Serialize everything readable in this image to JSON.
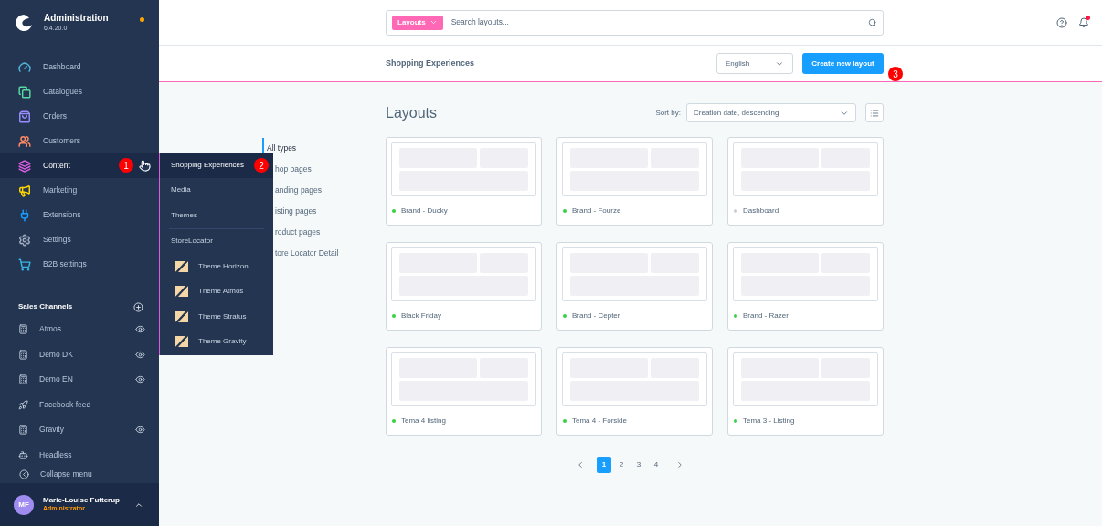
{
  "app": {
    "title": "Administration",
    "version": "6.4.20.0"
  },
  "sidebar": {
    "items": [
      {
        "label": "Dashboard",
        "color": "#4fb3d9",
        "selected": false
      },
      {
        "label": "Catalogues",
        "color": "#57d9a3",
        "selected": false
      },
      {
        "label": "Orders",
        "color": "#9a8cff",
        "selected": false
      },
      {
        "label": "Customers",
        "color": "#ff8a65",
        "selected": false
      },
      {
        "label": "Content",
        "color": "#d95fe0",
        "selected": true
      },
      {
        "label": "Marketing",
        "color": "#ffd700",
        "selected": false
      },
      {
        "label": "Extensions",
        "color": "#189eff",
        "selected": false
      },
      {
        "label": "Settings",
        "color": "#a0aec0",
        "selected": false
      },
      {
        "label": "B2B settings",
        "color": "#37b5e6",
        "selected": false
      }
    ]
  },
  "sales_channels": {
    "title": "Sales Channels",
    "items": [
      {
        "label": "Atmos",
        "kind": "storefront",
        "preview": true
      },
      {
        "label": "Demo DK",
        "kind": "storefront",
        "preview": true
      },
      {
        "label": "Demo EN",
        "kind": "storefront",
        "preview": true
      },
      {
        "label": "Facebook feed",
        "kind": "feed",
        "preview": false
      },
      {
        "label": "Gravity",
        "kind": "storefront",
        "preview": true
      },
      {
        "label": "Headless",
        "kind": "headless",
        "preview": false
      }
    ]
  },
  "collapse_menu": "Collapse menu",
  "user": {
    "initials": "MF",
    "name": "Marie-Louise Futterup",
    "role": "Administrator"
  },
  "submenu": {
    "items": [
      {
        "label": "Shopping Experiences",
        "selected": true
      },
      {
        "label": "Media",
        "selected": false
      },
      {
        "label": "Themes",
        "selected": false
      },
      {
        "label": "StoreLocator",
        "selected": false,
        "children": [
          {
            "label": "Theme Horizon"
          },
          {
            "label": "Theme Atmos"
          },
          {
            "label": "Theme Stratus"
          },
          {
            "label": "Theme Gravity"
          }
        ]
      }
    ]
  },
  "badges": [
    "1",
    "2",
    "3"
  ],
  "search": {
    "filter": "Layouts",
    "placeholder": "Search layouts..."
  },
  "page_title": "Shopping Experiences",
  "language": "English",
  "create_button": "Create new layout",
  "layouts": {
    "title": "Layouts",
    "sort_label": "Sort by:",
    "sort_value": "Creation date, descending",
    "types": [
      {
        "label": "All types",
        "selected": true
      },
      {
        "label": "hop pages",
        "selected": false
      },
      {
        "label": "anding pages",
        "selected": false
      },
      {
        "label": "isting pages",
        "selected": false
      },
      {
        "label": "roduct pages",
        "selected": false
      },
      {
        "label": "tore Locator Detail",
        "selected": false
      }
    ],
    "cards": [
      {
        "name": "Brand - Ducky",
        "color": "#37d046"
      },
      {
        "name": "Brand - Fourze",
        "color": "#37d046"
      },
      {
        "name": "Dashboard",
        "color": "#c6ced7"
      },
      {
        "name": "Black Friday",
        "color": "#37d046"
      },
      {
        "name": "Brand - Cepter",
        "color": "#37d046"
      },
      {
        "name": "Brand - Razer",
        "color": "#37d046"
      },
      {
        "name": "Tema 4 listing",
        "color": "#37d046"
      },
      {
        "name": "Tema 4 - Forside",
        "color": "#37d046"
      },
      {
        "name": "Tema 3 - Listing",
        "color": "#37d046"
      }
    ],
    "pages": [
      {
        "label": "1",
        "selected": true
      },
      {
        "label": "2",
        "selected": false
      },
      {
        "label": "3",
        "selected": false
      },
      {
        "label": "4",
        "selected": false
      }
    ]
  }
}
